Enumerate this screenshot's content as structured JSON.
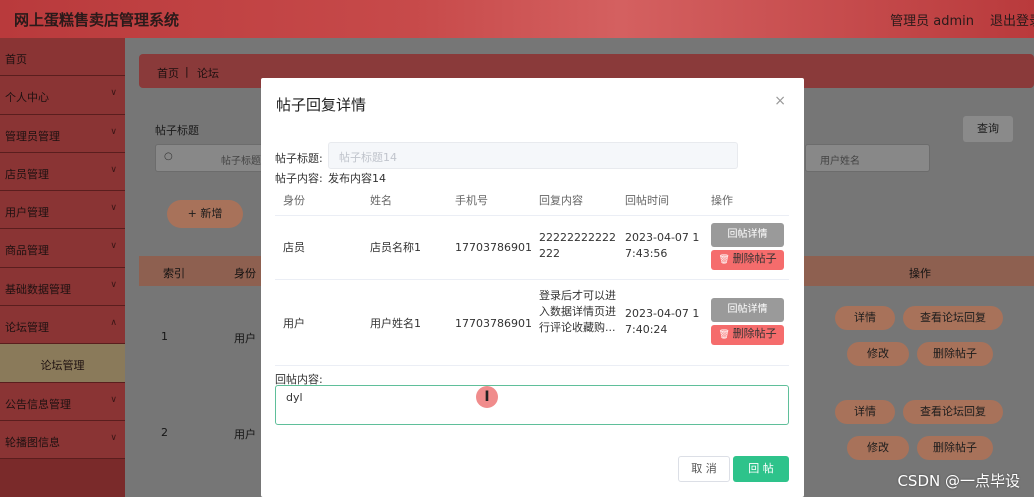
{
  "header": {
    "title": "网上蛋糕售卖店管理系统",
    "user": "管理员 admin",
    "logout": "退出登录"
  },
  "sidebar": {
    "items": [
      {
        "label": "首页",
        "chevron": false
      },
      {
        "label": "个人中心",
        "chevron": true
      },
      {
        "label": "管理员管理",
        "chevron": true
      },
      {
        "label": "店员管理",
        "chevron": true
      },
      {
        "label": "用户管理",
        "chevron": true
      },
      {
        "label": "商品管理",
        "chevron": true
      },
      {
        "label": "基础数据管理",
        "chevron": true
      },
      {
        "label": "论坛管理",
        "chevron": true
      },
      {
        "label": "论坛管理",
        "chevron": false,
        "sub": true
      },
      {
        "label": "公告信息管理",
        "chevron": true
      },
      {
        "label": "轮播图信息",
        "chevron": true
      }
    ]
  },
  "breadcrumb": {
    "home": "首页",
    "sep": "|",
    "current": "论坛"
  },
  "filters": {
    "title_label": "帖子标题",
    "title_placeholder": "帖子标题",
    "user_placeholder": "用户姓名",
    "search_btn": "查询"
  },
  "toolbar": {
    "add_btn": "+ 新增"
  },
  "list_table": {
    "headers": [
      "索引",
      "身份",
      "操作"
    ],
    "rows": [
      {
        "index": "1",
        "identity": "用户"
      },
      {
        "index": "2",
        "identity": "用户"
      }
    ],
    "actions": {
      "detail": "详情",
      "view_reply": "查看论坛回复",
      "edit": "修改",
      "delete": "删除帖子"
    }
  },
  "modal": {
    "title": "帖子回复详情",
    "close": "×",
    "post_title_label": "帖子标题:",
    "post_title_value": "帖子标题14",
    "post_content_label": "帖子内容:",
    "post_content_value": "发布内容14",
    "table_headers": [
      "身份",
      "姓名",
      "手机号",
      "回复内容",
      "回帖时间",
      "操作"
    ],
    "rows": [
      {
        "identity": "店员",
        "name": "店员名称1",
        "phone": "17703786901",
        "content": "22222222222222",
        "time": "2023-04-07 17:43:56"
      },
      {
        "identity": "用户",
        "name": "用户姓名1",
        "phone": "17703786901",
        "content": "登录后才可以进入数据详情页进行评论收藏购...",
        "time": "2023-04-07 17:40:24"
      }
    ],
    "row_detail_btn": "回帖详情",
    "row_delete_btn": "删除帖子",
    "reply_label": "回帖内容:",
    "reply_value": "dyl",
    "cancel_btn": "取 消",
    "submit_btn": "回 帖"
  },
  "watermark": "CSDN @一点毕设",
  "colors": {
    "accent": "#b93a3c",
    "success": "#2ec38b",
    "danger": "#f56c6c"
  }
}
